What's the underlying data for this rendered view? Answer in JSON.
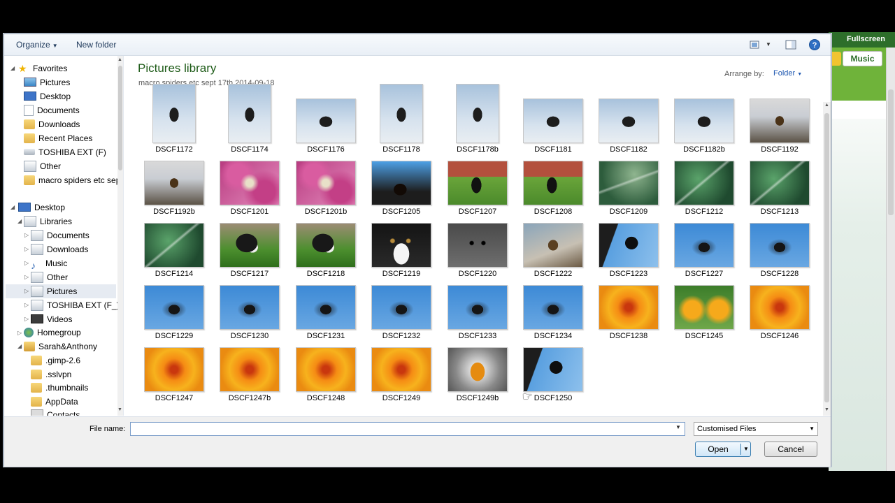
{
  "background_app": {
    "fullscreen_label": "Fullscreen",
    "music_label": "Music"
  },
  "toolbar": {
    "organize_label": "Organize",
    "new_folder_label": "New folder",
    "icons": [
      "view-options-icon",
      "preview-pane-icon",
      "help-icon"
    ]
  },
  "nav": {
    "favorites_label": "Favorites",
    "favorites": [
      "Pictures",
      "Desktop",
      "Documents",
      "Downloads",
      "Recent Places",
      "TOSHIBA EXT (F)",
      "Other",
      "macro spiders etc sept"
    ],
    "desktop_label": "Desktop",
    "libraries_label": "Libraries",
    "libraries": [
      "Documents",
      "Downloads",
      "Music",
      "Other",
      "Pictures",
      "TOSHIBA EXT (F_)",
      "Videos"
    ],
    "homegroup_label": "Homegroup",
    "user_label": "Sarah&Anthony",
    "user_folders": [
      ".gimp-2.6",
      ".sslvpn",
      ".thumbnails",
      "AppData",
      "Contacts"
    ]
  },
  "content": {
    "title": "Pictures library",
    "subtitle": "macro spiders etc sept 17th 2014-09-18",
    "arrange_label": "Arrange by:",
    "arrange_value": "Folder"
  },
  "files": [
    {
      "name": "DSCF1172",
      "scene": "spider-sky",
      "orient": "port"
    },
    {
      "name": "DSCF1174",
      "scene": "spider-sky",
      "orient": "port"
    },
    {
      "name": "DSCF1176",
      "scene": "spider-sky",
      "orient": "land"
    },
    {
      "name": "DSCF1178",
      "scene": "spider-sky",
      "orient": "port"
    },
    {
      "name": "DSCF1178b",
      "scene": "spider-sky",
      "orient": "port"
    },
    {
      "name": "DSCF1181",
      "scene": "spider-sky",
      "orient": "land"
    },
    {
      "name": "DSCF1182",
      "scene": "spider-sky",
      "orient": "land"
    },
    {
      "name": "DSCF1182b",
      "scene": "spider-sky",
      "orient": "land"
    },
    {
      "name": "DSCF1192",
      "scene": "spider-roof",
      "orient": "land"
    },
    {
      "name": "DSCF1192b",
      "scene": "spider-roof",
      "orient": "land"
    },
    {
      "name": "DSCF1201",
      "scene": "pink",
      "orient": "land"
    },
    {
      "name": "DSCF1201b",
      "scene": "pink",
      "orient": "land"
    },
    {
      "name": "DSCF1205",
      "scene": "black-spider-blue",
      "orient": "land"
    },
    {
      "name": "DSCF1207",
      "scene": "dog-garden",
      "orient": "land"
    },
    {
      "name": "DSCF1208",
      "scene": "dog-garden",
      "orient": "land"
    },
    {
      "name": "DSCF1209",
      "scene": "leaf",
      "orient": "land"
    },
    {
      "name": "DSCF1212",
      "scene": "leaf2",
      "orient": "land"
    },
    {
      "name": "DSCF1213",
      "scene": "leaf2",
      "orient": "land"
    },
    {
      "name": "DSCF1214",
      "scene": "leaf2",
      "orient": "land"
    },
    {
      "name": "DSCF1217",
      "scene": "dog-grass",
      "orient": "land"
    },
    {
      "name": "DSCF1218",
      "scene": "dog-grass",
      "orient": "land"
    },
    {
      "name": "DSCF1219",
      "scene": "dog-close",
      "orient": "land"
    },
    {
      "name": "DSCF1220",
      "scene": "dog-grey",
      "orient": "land"
    },
    {
      "name": "DSCF1222",
      "scene": "spider-brown",
      "orient": "land"
    },
    {
      "name": "DSCF1223",
      "scene": "spider-dark-blue",
      "orient": "land"
    },
    {
      "name": "DSCF1227",
      "scene": "spider-blue",
      "orient": "land"
    },
    {
      "name": "DSCF1228",
      "scene": "spider-blue",
      "orient": "land"
    },
    {
      "name": "DSCF1229",
      "scene": "spider-blue",
      "orient": "land"
    },
    {
      "name": "DSCF1230",
      "scene": "spider-blue",
      "orient": "land"
    },
    {
      "name": "DSCF1231",
      "scene": "spider-blue",
      "orient": "land"
    },
    {
      "name": "DSCF1232",
      "scene": "spider-blue",
      "orient": "land"
    },
    {
      "name": "DSCF1233",
      "scene": "spider-blue",
      "orient": "land"
    },
    {
      "name": "DSCF1234",
      "scene": "spider-blue",
      "orient": "land"
    },
    {
      "name": "DSCF1238",
      "scene": "orange",
      "orient": "land"
    },
    {
      "name": "DSCF1245",
      "scene": "orange-green",
      "orient": "land"
    },
    {
      "name": "DSCF1246",
      "scene": "orange",
      "orient": "land"
    },
    {
      "name": "DSCF1247",
      "scene": "orange",
      "orient": "land"
    },
    {
      "name": "DSCF1247b",
      "scene": "orange",
      "orient": "land"
    },
    {
      "name": "DSCF1248",
      "scene": "orange",
      "orient": "land"
    },
    {
      "name": "DSCF1249",
      "scene": "orange",
      "orient": "land"
    },
    {
      "name": "DSCF1249b",
      "scene": "orange-grey",
      "orient": "land"
    },
    {
      "name": "DSCF1250",
      "scene": "spider-dark-blue",
      "orient": "land"
    }
  ],
  "bottom": {
    "filename_label": "File name:",
    "filename_value": "",
    "filter_value": "Customised Files",
    "open_label": "Open",
    "cancel_label": "Cancel"
  }
}
